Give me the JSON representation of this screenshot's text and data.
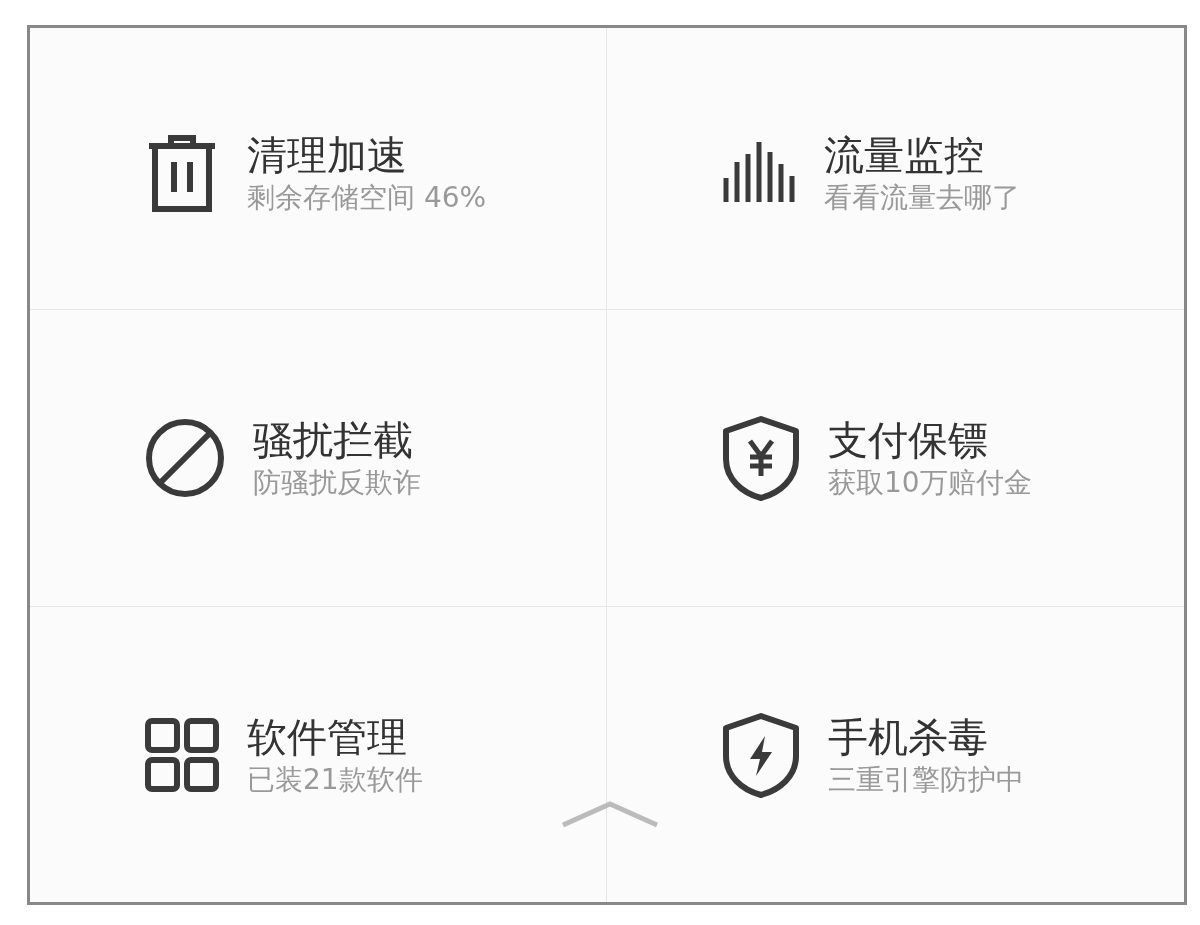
{
  "tiles": [
    {
      "kind": "trash",
      "title": "清理加速",
      "subtitle": "剩余存储空间 46%"
    },
    {
      "kind": "bars",
      "title": "流量监控",
      "subtitle": "看看流量去哪了"
    },
    {
      "kind": "ban",
      "title": "骚扰拦截",
      "subtitle": "防骚扰反欺诈"
    },
    {
      "kind": "shield-yen",
      "title": "支付保镖",
      "subtitle": "获取10万赔付金"
    },
    {
      "kind": "grid",
      "title": "软件管理",
      "subtitle": "已装21款软件"
    },
    {
      "kind": "shield-bolt",
      "title": "手机杀毒",
      "subtitle": "三重引擎防护中"
    }
  ]
}
